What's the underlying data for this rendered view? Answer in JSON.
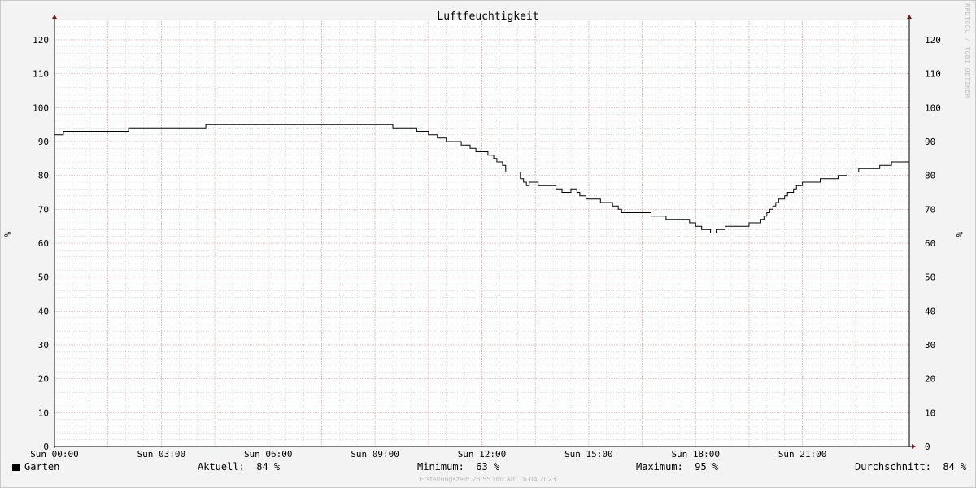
{
  "chart_data": {
    "type": "line",
    "title": "Luftfeuchtigkeit",
    "ylabel": "%",
    "ylabel_right": "%",
    "ylim": [
      0,
      126
    ],
    "yticks": [
      0,
      10,
      20,
      30,
      40,
      50,
      60,
      70,
      80,
      90,
      100,
      110,
      120
    ],
    "xlim_hours": [
      0,
      24
    ],
    "xticks": [
      {
        "h": 0,
        "label": "Sun 00:00"
      },
      {
        "h": 3,
        "label": "Sun 03:00"
      },
      {
        "h": 6,
        "label": "Sun 06:00"
      },
      {
        "h": 9,
        "label": "Sun 09:00"
      },
      {
        "h": 12,
        "label": "Sun 12:00"
      },
      {
        "h": 15,
        "label": "Sun 15:00"
      },
      {
        "h": 18,
        "label": "Sun 18:00"
      },
      {
        "h": 21,
        "label": "Sun 21:00"
      }
    ],
    "grid": true,
    "colors": {
      "line": "#000000",
      "major_grid": "#e8a0a8",
      "minor_grid": "#c8c8c8",
      "axis": "#7a1010"
    },
    "series": [
      {
        "name": "Garten",
        "points": [
          [
            0.0,
            92
          ],
          [
            0.25,
            93
          ],
          [
            2.08,
            94
          ],
          [
            4.25,
            95
          ],
          [
            9.5,
            94
          ],
          [
            10.17,
            93
          ],
          [
            10.5,
            92
          ],
          [
            10.75,
            91
          ],
          [
            11.0,
            90
          ],
          [
            11.42,
            89
          ],
          [
            11.67,
            88
          ],
          [
            11.83,
            87
          ],
          [
            12.17,
            86
          ],
          [
            12.33,
            85
          ],
          [
            12.42,
            84
          ],
          [
            12.58,
            83
          ],
          [
            12.67,
            81
          ],
          [
            12.92,
            81
          ],
          [
            13.08,
            79
          ],
          [
            13.17,
            78
          ],
          [
            13.25,
            77
          ],
          [
            13.33,
            78
          ],
          [
            13.58,
            77
          ],
          [
            14.08,
            76
          ],
          [
            14.25,
            75
          ],
          [
            14.5,
            76
          ],
          [
            14.67,
            75
          ],
          [
            14.75,
            74
          ],
          [
            14.92,
            73
          ],
          [
            15.33,
            72
          ],
          [
            15.67,
            71
          ],
          [
            15.83,
            70
          ],
          [
            15.92,
            69
          ],
          [
            16.75,
            68
          ],
          [
            17.17,
            67
          ],
          [
            17.83,
            66
          ],
          [
            18.0,
            65
          ],
          [
            18.17,
            64
          ],
          [
            18.42,
            63
          ],
          [
            18.58,
            64
          ],
          [
            18.83,
            65
          ],
          [
            19.5,
            66
          ],
          [
            19.83,
            67
          ],
          [
            19.92,
            68
          ],
          [
            20.0,
            69
          ],
          [
            20.08,
            70
          ],
          [
            20.17,
            71
          ],
          [
            20.25,
            72
          ],
          [
            20.33,
            73
          ],
          [
            20.5,
            74
          ],
          [
            20.58,
            75
          ],
          [
            20.75,
            76
          ],
          [
            20.83,
            77
          ],
          [
            21.0,
            78
          ],
          [
            21.5,
            79
          ],
          [
            22.0,
            80
          ],
          [
            22.25,
            81
          ],
          [
            22.58,
            82
          ],
          [
            23.17,
            83
          ],
          [
            23.5,
            84
          ],
          [
            24.0,
            84
          ]
        ]
      }
    ]
  },
  "legend": {
    "series_name": "Garten",
    "current": "Aktuell:  84 %",
    "minimum": "Minimum:  63 %",
    "maximum": "Maximum:  95 %",
    "average": "Durchschnitt:  84 %"
  },
  "footer": "Erstellungszeit: 23:55 Uhr am 16.04.2023",
  "watermark": "RRDTOOL / TOBI OETIKER"
}
